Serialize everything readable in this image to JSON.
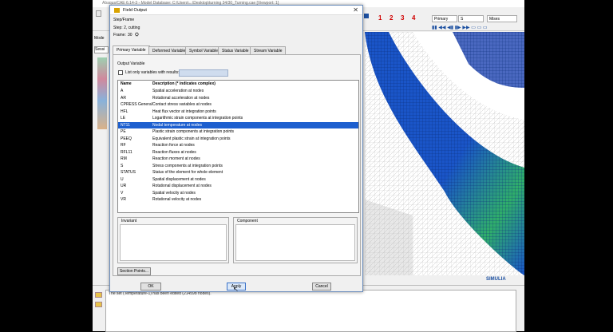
{
  "app": {
    "title": "Abaqus/CAE 6.14-3 - Model Database: C:\\Users\\...\\Desktop\\turning 34/30_Turning.cae [Viewport: 1]",
    "toolbar": {
      "numbers": [
        "1",
        "2",
        "3",
        "4"
      ],
      "step_combo": "Primary",
      "var_combo": "S",
      "invariant_combo": "Mises"
    },
    "model_label": "Mode",
    "session_label": "Sessi",
    "message": "The set  (Temperature-1)  has been edited (214598 nodes).",
    "logo": "SIMULIA"
  },
  "dialog": {
    "title": "Field Output",
    "step_frame_header": "Step/Frame",
    "step_text": "Step:  2, cutting",
    "frame_label": "Frame:",
    "frame_value": "30",
    "tabs": [
      "Primary Variable",
      "Deformed Variable",
      "Symbol Variable",
      "Status Variable",
      "Stream Variable"
    ],
    "output_variable_label": "Output Variable",
    "filter_label": "List only variables with results:",
    "columns": {
      "name": "Name",
      "description": "Description (* indicates complex)"
    },
    "rows": [
      {
        "name": "A",
        "desc": "Spatial acceleration at nodes"
      },
      {
        "name": "AR",
        "desc": "Rotational acceleration at nodes"
      },
      {
        "name": "CPRESS   General",
        "desc": "Contact stress variables at nodes"
      },
      {
        "name": "HFL",
        "desc": "Heat flux vector at integration points"
      },
      {
        "name": "LE",
        "desc": "Logarithmic strain components at integration points"
      },
      {
        "name": "NT11",
        "desc": "Nodal temperature at nodes"
      },
      {
        "name": "PE",
        "desc": "Plastic strain components at integration points"
      },
      {
        "name": "PEEQ",
        "desc": "Equivalent plastic strain at integration points"
      },
      {
        "name": "RF",
        "desc": "Reaction force at nodes"
      },
      {
        "name": "RFL11",
        "desc": "Reaction fluxes at nodes"
      },
      {
        "name": "RM",
        "desc": "Reaction moment at nodes"
      },
      {
        "name": "S",
        "desc": "Stress components at integration points"
      },
      {
        "name": "STATUS",
        "desc": "Status of the element for whole element"
      },
      {
        "name": "U",
        "desc": "Spatial displacement at nodes"
      },
      {
        "name": "UR",
        "desc": "Rotational displacement at nodes"
      },
      {
        "name": "V",
        "desc": "Spatial velocity at nodes"
      },
      {
        "name": "VR",
        "desc": "Rotational velocity at nodes"
      }
    ],
    "selected_row": "NT11",
    "invariant_label": "Invariant",
    "component_label": "Component",
    "section_points_button": "Section Points...",
    "ok_button": "OK",
    "apply_button": "Apply",
    "cancel_button": "Cancel"
  },
  "colors": {
    "selection": "#1d5fcf",
    "mesh_blue": "#1a55c8",
    "mesh_green": "#2fae6a"
  }
}
